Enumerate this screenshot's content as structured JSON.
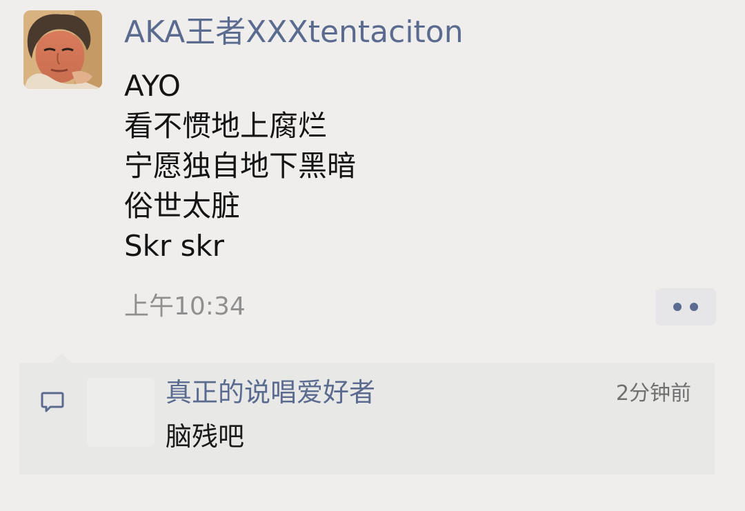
{
  "post": {
    "author": "AKA王者XXXtentaciton",
    "lines": [
      "AYO",
      "看不惯地上腐烂",
      "宁愿独自地下黑暗",
      "俗世太脏",
      "Skr skr"
    ],
    "time": "上午10:34"
  },
  "comment": {
    "author": "真正的说唱爱好者",
    "text": "脑残吧",
    "time": "2分钟前"
  },
  "icons": {
    "avatar": "user-avatar-photo",
    "more": "more-dots-icon",
    "comment": "comment-bubble-icon"
  },
  "colors": {
    "background": "#efeeed",
    "name_link": "#5a6b8f",
    "body_text": "#141414",
    "secondary_text": "#8f8f8f",
    "comment_panel": "#e8e8e7"
  }
}
